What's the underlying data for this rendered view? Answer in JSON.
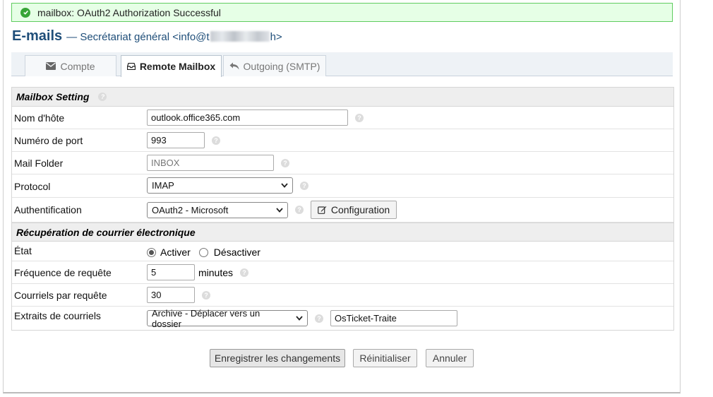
{
  "notice": {
    "text": "mailbox: OAuth2 Authorization Successful"
  },
  "title": {
    "main": "E-mails",
    "sub_prefix": "— Secrétariat général <info@t",
    "sub_suffix": "h>"
  },
  "tabs": [
    {
      "label": "Compte",
      "icon": "envelope-icon",
      "active": false
    },
    {
      "label": "Remote Mailbox",
      "icon": "inbox-icon",
      "active": true
    },
    {
      "label": "Outgoing (SMTP)",
      "icon": "reply-icon",
      "active": false
    }
  ],
  "mailbox_section": {
    "title": "Mailbox Setting",
    "hostname": {
      "label": "Nom d'hôte",
      "value": "outlook.office365.com"
    },
    "port": {
      "label": "Numéro de port",
      "value": "993"
    },
    "folder": {
      "label": "Mail Folder",
      "placeholder": "INBOX"
    },
    "protocol": {
      "label": "Protocol",
      "value": "IMAP"
    },
    "auth": {
      "label": "Authentification",
      "value": "OAuth2 - Microsoft",
      "config_button": "Configuration"
    }
  },
  "fetch_section": {
    "title": "Récupération de courrier électronique",
    "status": {
      "label": "État",
      "option_on": "Activer",
      "option_off": "Désactiver",
      "selected": "Activer"
    },
    "frequency": {
      "label": "Fréquence de requête",
      "value": "5",
      "unit": "minutes"
    },
    "per_fetch": {
      "label": "Courriels par requête",
      "value": "30"
    },
    "archive": {
      "label": "Extraits de courriels",
      "value": "Archive - Déplacer vers un dossier",
      "folder_value": "OsTicket-Traite"
    }
  },
  "buttons": {
    "save": "Enregistrer les changements",
    "reset": "Réinitialiser",
    "cancel": "Annuler"
  },
  "colors": {
    "title": "#1f4e79",
    "notice_bg": "#e6ffe6",
    "notice_border": "#5fcc5f"
  }
}
